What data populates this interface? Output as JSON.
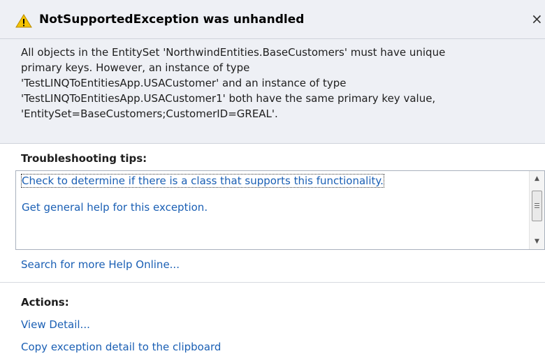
{
  "dialog": {
    "title": "NotSupportedException was unhandled",
    "close_glyph": "×",
    "message": "All objects in the EntitySet 'NorthwindEntities.BaseCustomers' must have unique\nprimary keys. However, an instance of type\n'TestLINQToEntitiesApp.USACustomer' and an instance of type\n'TestLINQToEntitiesApp.USACustomer1' both have the same primary key value,\n'EntitySet=BaseCustomers;CustomerID=GREAL'."
  },
  "troubleshooting": {
    "heading": "Troubleshooting tips:",
    "tips": [
      "Check to determine if there is a class that supports this functionality.",
      "Get general help for this exception."
    ],
    "search_link": "Search for more Help Online..."
  },
  "actions": {
    "heading": "Actions:",
    "view_detail": "View Detail...",
    "copy_detail": "Copy exception detail to the clipboard"
  },
  "icons": {
    "warning": "warning-triangle-icon",
    "close": "close-icon",
    "scroll_up": "scroll-up-arrow-icon",
    "scroll_down": "scroll-down-arrow-icon"
  },
  "colors": {
    "header_bg": "#eef0f5",
    "link": "#1a5fb4",
    "warning_yellow": "#f5c400"
  }
}
